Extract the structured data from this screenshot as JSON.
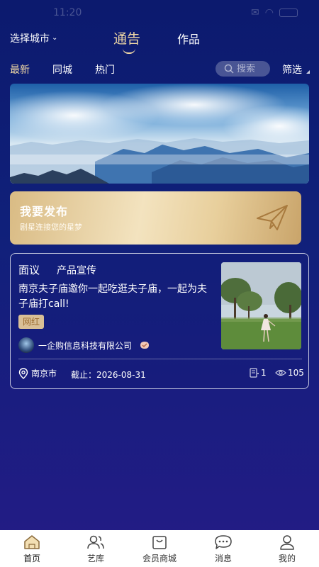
{
  "status_bar": {
    "time": "11:20"
  },
  "header": {
    "city_select": "选择城市",
    "tabs": [
      {
        "label": "通告",
        "active": true
      },
      {
        "label": "作品",
        "active": false
      }
    ]
  },
  "sub_nav": {
    "tabs": [
      {
        "label": "最新",
        "active": true
      },
      {
        "label": "同城",
        "active": false
      },
      {
        "label": "热门",
        "active": false
      }
    ],
    "search_placeholder": "搜索",
    "filter_label": "筛选"
  },
  "publish_card": {
    "title": "我要发布",
    "subtitle": "剧星连接您的星梦"
  },
  "post": {
    "type": "面议",
    "category": "产品宣传",
    "title": "南京夫子庙邀你一起吃逛夫子庙，一起为夫子庙打call!",
    "tag": "网红",
    "company": "一企购信息科技有限公司",
    "location": "南京市",
    "deadline": "截止：2026-08-31",
    "applies": "1",
    "views": "105"
  },
  "bottom_nav": {
    "items": [
      {
        "label": "首页",
        "icon": "home-icon",
        "active": true
      },
      {
        "label": "艺库",
        "icon": "users-icon",
        "active": false
      },
      {
        "label": "会员商城",
        "icon": "shopping-bag-icon",
        "active": false
      },
      {
        "label": "消息",
        "icon": "message-icon",
        "active": false
      },
      {
        "label": "我的",
        "icon": "user-icon",
        "active": false
      }
    ]
  },
  "colors": {
    "accent_gold": "#f1d9a6",
    "background_top": "#0c1a6e",
    "background_bottom": "#241c86"
  }
}
